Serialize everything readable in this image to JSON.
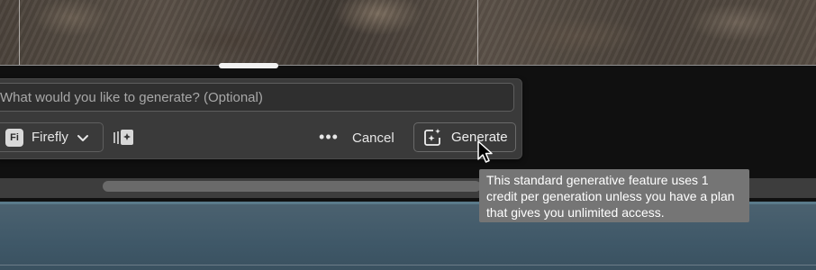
{
  "prompt": {
    "placeholder": "What would you like to generate? (Optional)",
    "value": ""
  },
  "model": {
    "badge": "Fi",
    "label": "Firefly"
  },
  "actions": {
    "more_label": "•••",
    "cancel_label": "Cancel",
    "generate_label": "Generate"
  },
  "tooltip": {
    "text": "This standard generative feature uses 1 credit per generation unless you have a plan that gives you unlimited access."
  },
  "icons": {
    "model": "firefly-badge-icon",
    "model_dropdown": "chevron-down-icon",
    "reference": "reference-image-icon",
    "more": "more-options-icon",
    "generate": "generate-sparkle-icon",
    "cursor": "mouse-pointer-icon"
  },
  "colors": {
    "panel": "#3a3a3a",
    "tooltip": "#757575",
    "bottom_area": "#4c6270"
  }
}
